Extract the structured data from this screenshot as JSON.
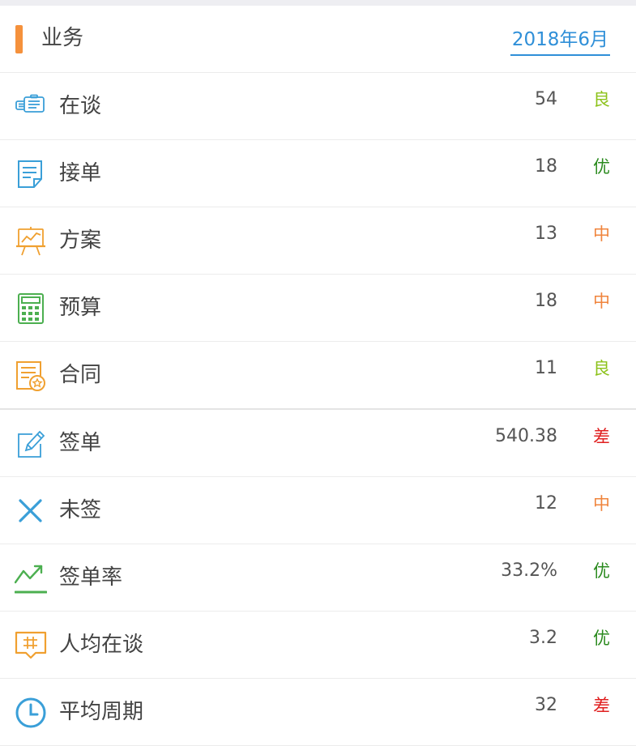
{
  "header": {
    "title": "业务",
    "date": "2018年6月",
    "accent_color": "#f5913c",
    "date_color": "#2f8fd8"
  },
  "grade_colors": {
    "优": "#2a8a1e",
    "良": "#8cc21a",
    "中": "#f0843c",
    "差": "#e02020"
  },
  "rows": [
    {
      "label": "在谈",
      "value": "54",
      "grade": "良",
      "icon": "chat-bubbles-icon",
      "icon_color": "#3a9fd8"
    },
    {
      "label": "接单",
      "value": "18",
      "grade": "优",
      "icon": "document-edit-icon",
      "icon_color": "#3a9fd8"
    },
    {
      "label": "方案",
      "value": "13",
      "grade": "中",
      "icon": "presentation-board-icon",
      "icon_color": "#f0a030"
    },
    {
      "label": "预算",
      "value": "18",
      "grade": "中",
      "icon": "calculator-icon",
      "icon_color": "#4caf50"
    },
    {
      "label": "合同",
      "value": "11",
      "grade": "良",
      "icon": "contract-seal-icon",
      "icon_color": "#f0a030"
    },
    {
      "label": "签单",
      "value": "540.38",
      "grade": "差",
      "icon": "pencil-sign-icon",
      "icon_color": "#3a9fd8"
    },
    {
      "label": "未签",
      "value": "12",
      "grade": "中",
      "icon": "close-x-icon",
      "icon_color": "#3a9fd8"
    },
    {
      "label": "签单率",
      "value": "33.2%",
      "grade": "优",
      "icon": "trend-up-icon",
      "icon_color": "#4caf50"
    },
    {
      "label": "人均在谈",
      "value": "3.2",
      "grade": "优",
      "icon": "hash-message-icon",
      "icon_color": "#f0a030"
    },
    {
      "label": "平均周期",
      "value": "32",
      "grade": "差",
      "icon": "clock-icon",
      "icon_color": "#3a9fd8"
    }
  ]
}
